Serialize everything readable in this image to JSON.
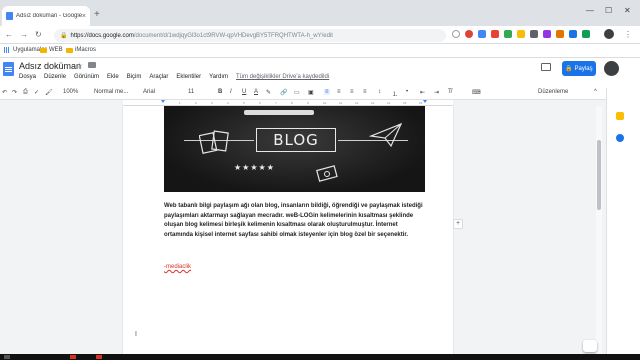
{
  "browser": {
    "tab_title": "Adsız doküman - Google Doküm...",
    "tab_close": "×",
    "new_tab": "+",
    "url_host": "https://docs.google.com",
    "url_path": "/document/d/1wdjqyGl3o1ct9RVW-qpVHDevgBY5TFRQHTWTA-h_wY/edit",
    "window_min": "—",
    "window_max": "☐",
    "window_close": "✕",
    "bookmarks": [
      "Uygulamalar",
      "WEB",
      "iMacros"
    ]
  },
  "docs": {
    "title": "Adsız doküman",
    "star": "☆",
    "menu": [
      "Dosya",
      "Düzenle",
      "Görünüm",
      "Ekle",
      "Biçim",
      "Araçlar",
      "Eklentiler",
      "Yardım"
    ],
    "last_edit": "Tüm değişiklikler Drive'a kaydedildi",
    "share": "🔒 Paylaş"
  },
  "toolbar": {
    "zoom": "100%",
    "style": "Normal me...",
    "font": "Arial",
    "size": "11",
    "bold": "B",
    "italic": "I",
    "underline": "U",
    "text_color": "A",
    "mode": "Düzenleme"
  },
  "ruler": {
    "marks": [
      "1",
      "2",
      "3",
      "4",
      "5",
      "6",
      "7",
      "8",
      "9",
      "10",
      "11",
      "12",
      "13",
      "14",
      "15",
      "16"
    ]
  },
  "document": {
    "image_word": "BLOG",
    "image_stars": "★★★★★",
    "paragraph": "Web tabanlı bilgi paylaşım ağı olan blog, insanların bildiği, öğrendiği ve paylaşmak istediği paylaşımları aktarmayı sağlayan mecradır. weB-LOGin kelimelerinin kısaltması şeklinde oluşan blog kelimesi birleşik kelimenin kısaltması olarak oluşturulmuştur. İnternet ortamında kişisel internet sayfası sahibi olmak isteyenler için blog özel bir seçenektir.",
    "signature": "-mediaclik",
    "text_cursor": "I",
    "add_comment": "+"
  },
  "colors": {
    "accent": "#1a73e8",
    "page": "#ffffff",
    "canvas": "#f1f3f4"
  }
}
